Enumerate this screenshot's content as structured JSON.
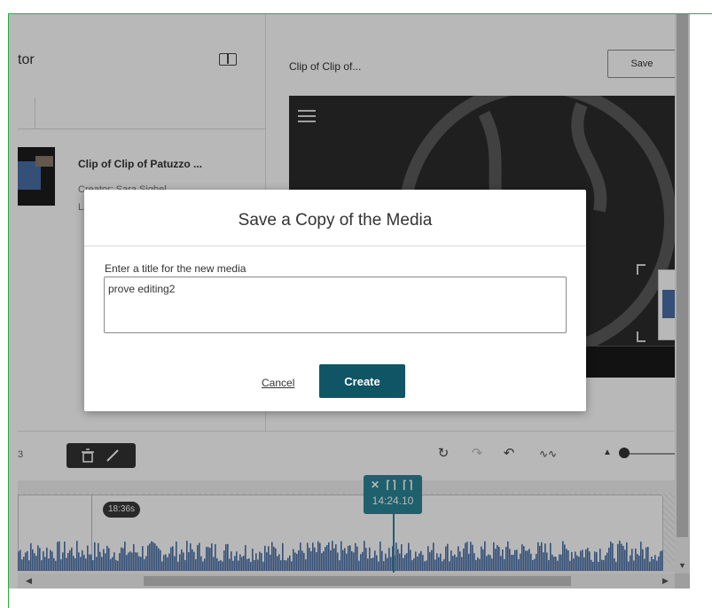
{
  "left_panel": {
    "title": "tor",
    "clip": {
      "title": "Clip of Clip of Patuzzo ...",
      "creator": "Creator: Sara Sighel",
      "last_line": "La"
    }
  },
  "right_panel": {
    "title": "Clip of Clip of...",
    "save_label": "Save"
  },
  "toolbar": {
    "left_number": "3",
    "icons": [
      "delete-icon",
      "edit-icon",
      "redo-history-icon",
      "redo-icon",
      "undo-icon",
      "waveform-icon",
      "zoom-slider"
    ]
  },
  "timeline": {
    "duration_badge": "18:36s",
    "playhead_icons": "✕ ⌈⌉ ⌈⌉",
    "playhead_time": "14:24.10"
  },
  "modal": {
    "title": "Save a Copy of the Media",
    "field_label": "Enter a title for the new media",
    "input_value": "prove editing2",
    "cancel_label": "Cancel",
    "create_label": "Create"
  },
  "colors": {
    "accent": "#0f5566",
    "playhead": "#2a8596",
    "waveform": "#4a6fa5",
    "frame_border": "#2eaa3f"
  }
}
